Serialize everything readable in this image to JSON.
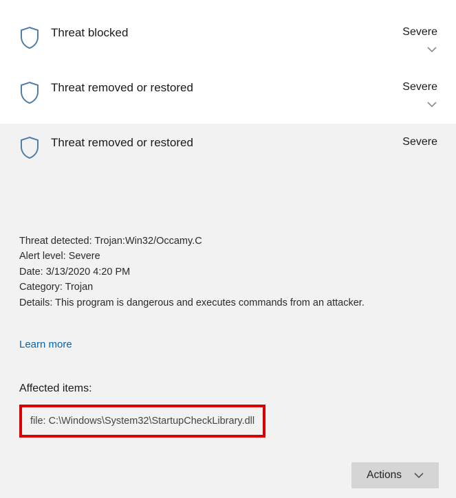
{
  "threats": [
    {
      "title": "Threat blocked",
      "severity": "Severe"
    },
    {
      "title": "Threat removed or restored",
      "severity": "Severe"
    },
    {
      "title": "Threat removed or restored",
      "severity": "Severe"
    }
  ],
  "details": {
    "threat_detected_label": "Threat detected:",
    "threat_detected_value": "Trojan:Win32/Occamy.C",
    "alert_level_label": "Alert level:",
    "alert_level_value": "Severe",
    "date_label": "Date:",
    "date_value": "3/13/2020 4:20 PM",
    "category_label": "Category:",
    "category_value": "Trojan",
    "details_label": "Details:",
    "details_value": "This program is dangerous and executes commands from an attacker.",
    "learn_more": "Learn more",
    "affected_heading": "Affected items:",
    "affected_item": "file: C:\\Windows\\System32\\StartupCheckLibrary.dll",
    "actions_label": "Actions"
  },
  "colors": {
    "shield_stroke": "#4f7ea6",
    "chevron_stroke": "#8a8a8a",
    "link": "#0066b4",
    "highlight_border": "#d80000",
    "button_bg": "#d5d5d5"
  }
}
